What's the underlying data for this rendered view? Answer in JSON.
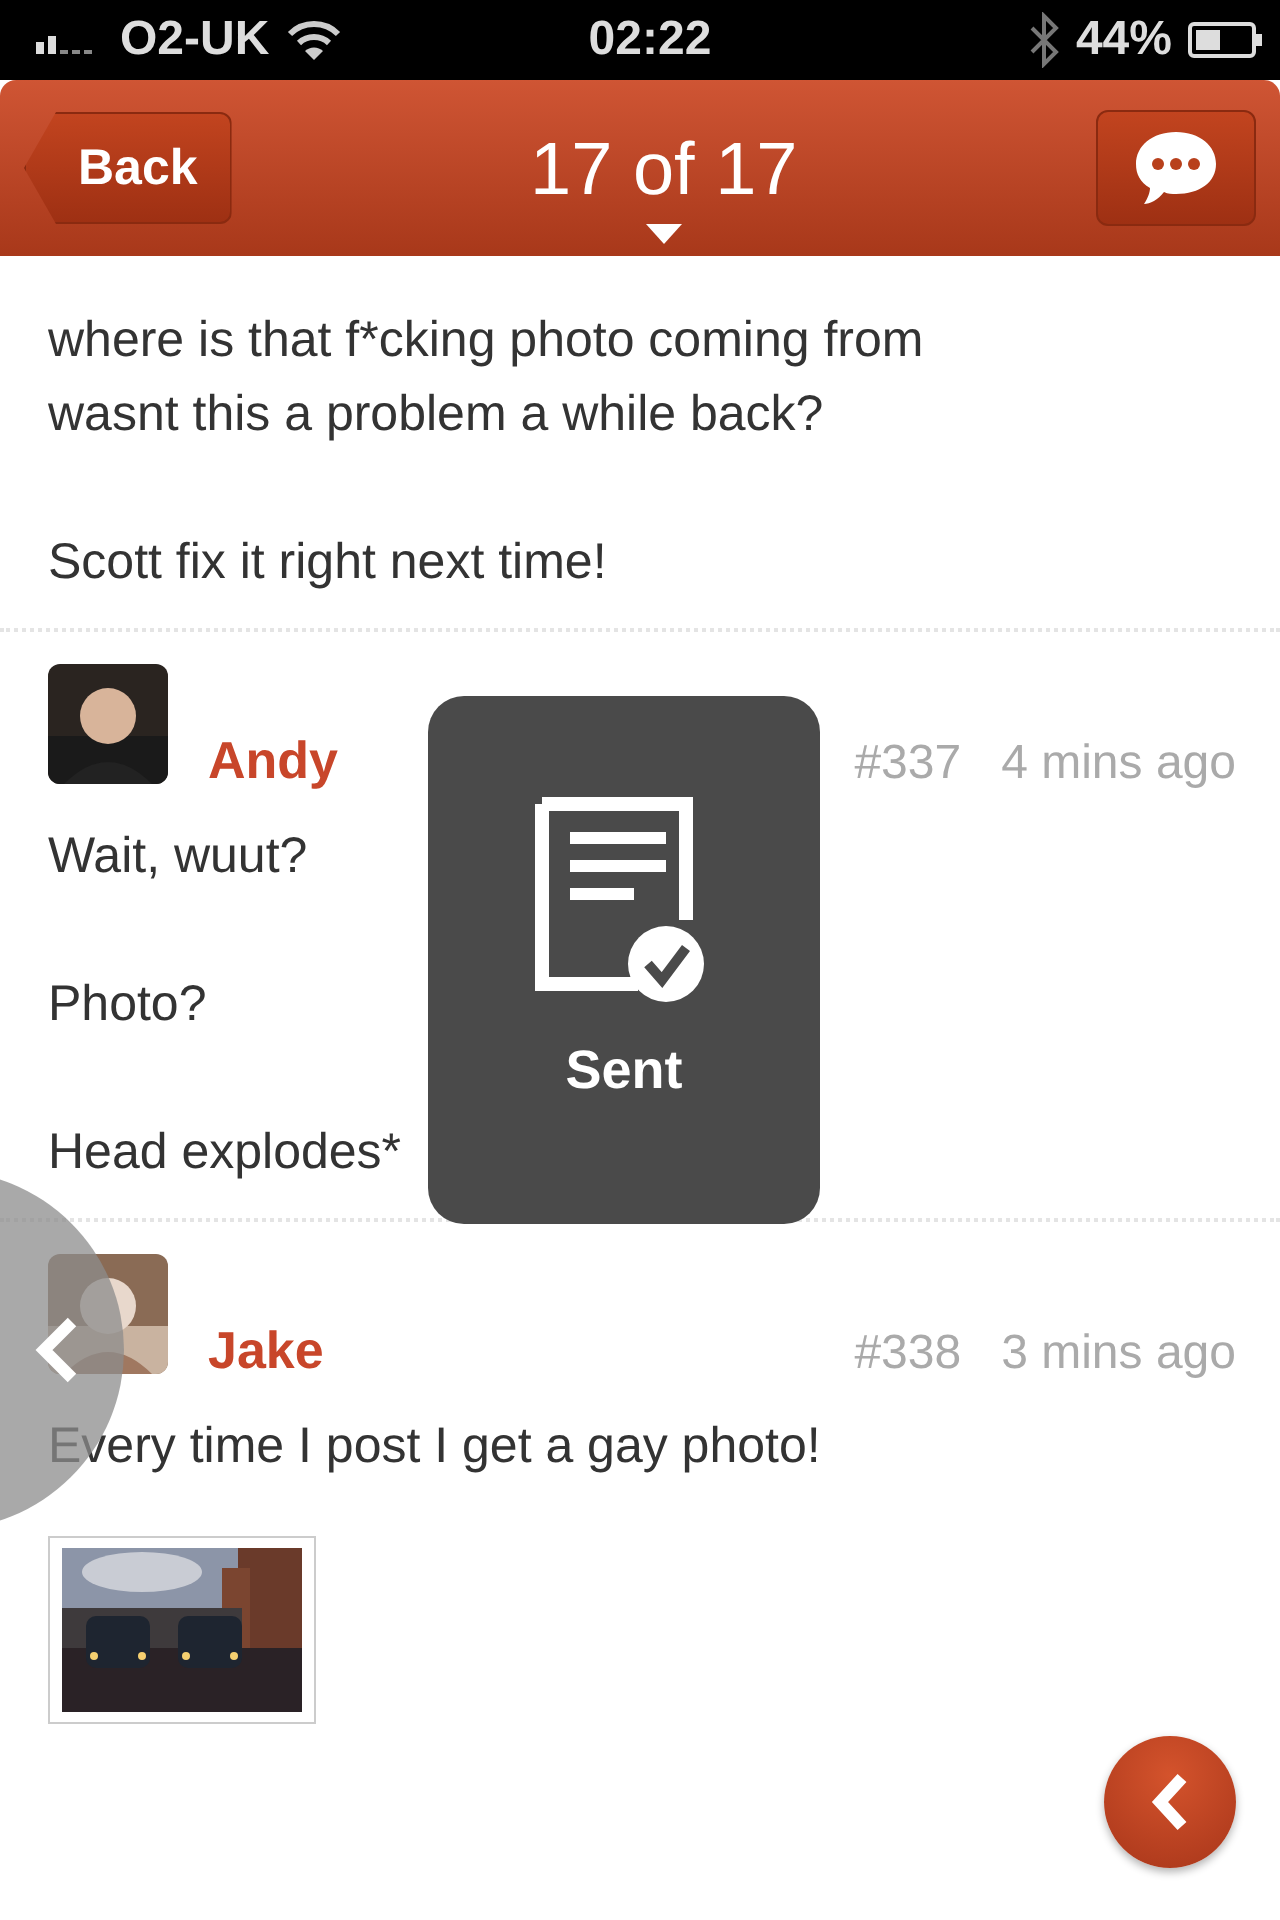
{
  "status_bar": {
    "carrier": "O2-UK",
    "time": "02:22",
    "battery": "44%"
  },
  "nav_bar": {
    "back": "Back",
    "title": "17 of 17"
  },
  "posts": [
    {
      "kind": "continuation",
      "paragraphs": [
        "where is that f*cking photo coming from\nwasnt this a problem a while back?",
        "Scott fix it right next time!"
      ]
    },
    {
      "kind": "post",
      "author": "Andy",
      "number": "#337",
      "time": "4 mins ago",
      "paragraphs": [
        "Wait, wuut?",
        "Photo?",
        "Head explodes*"
      ]
    },
    {
      "kind": "post",
      "author": "Jake",
      "number": "#338",
      "time": "3 mins ago",
      "paragraphs": [
        "Every time I post I get a gay photo!"
      ],
      "attachment": {
        "kind": "picture"
      }
    }
  ],
  "toast": {
    "label": "Sent"
  }
}
